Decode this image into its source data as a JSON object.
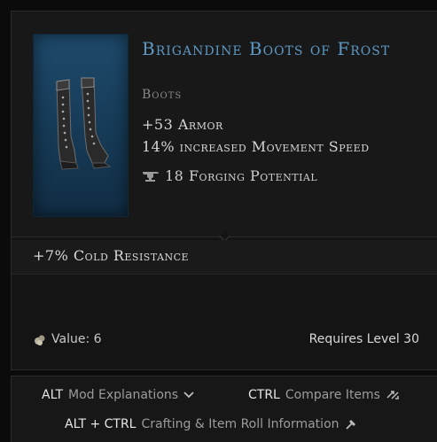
{
  "item": {
    "name": "Brigandine Boots of Frost",
    "type": "Boots",
    "image_icon": "boots-icon",
    "rarity_color": "#5d98c4",
    "frame_color": "#1e4a6c"
  },
  "stats": {
    "armor": "+53 Armor",
    "movement_speed": "14% increased Movement Speed"
  },
  "forging": {
    "icon": "anvil-icon",
    "text": "18 Forging Potential"
  },
  "affixes": [
    {
      "text": "+7% Cold Resistance"
    }
  ],
  "footer": {
    "value_icon": "coin-pouch-icon",
    "value_text": "Value: 6",
    "requirement_text": "Requires Level 30"
  },
  "hints": {
    "mod": {
      "key": "ALT",
      "label": "Mod Explanations",
      "icon": "chevron-down-icon"
    },
    "compare": {
      "key": "CTRL",
      "label": "Compare Items",
      "icon": "compare-arrows-icon"
    },
    "crafting": {
      "key": "ALT + CTRL",
      "label": "Crafting & Item Roll Information",
      "icon": "hammer-icon"
    }
  }
}
